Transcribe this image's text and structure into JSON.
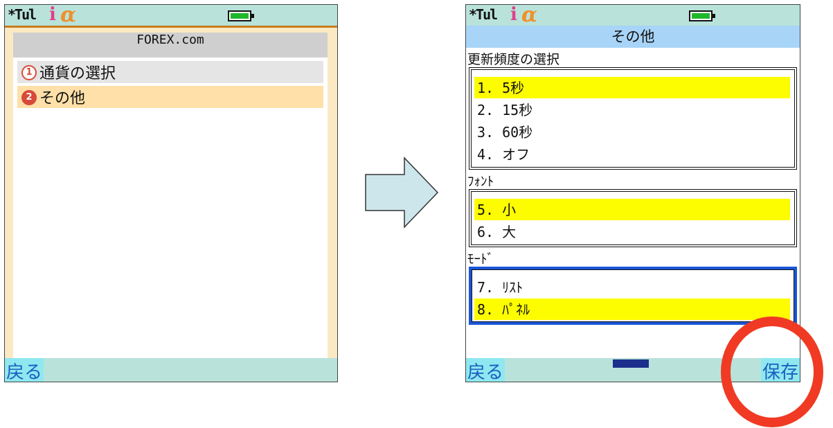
{
  "left_screen": {
    "status": {
      "signal": "*Tul",
      "imode": "i",
      "alpha": "α"
    },
    "title": "FOREX.com",
    "menu": [
      {
        "number": "1",
        "label": "通貨の選択"
      },
      {
        "number": "2",
        "label": "その他"
      }
    ],
    "softkey_left": "戻る"
  },
  "right_screen": {
    "status": {
      "signal": "*Tul",
      "imode": "i",
      "alpha": "α"
    },
    "title": "その他",
    "groups": [
      {
        "label": "更新頻度の選択",
        "options": [
          "1. 5秒",
          "2. 15秒",
          "3. 60秒",
          "4. オフ"
        ],
        "selected": 0
      },
      {
        "label": "ﾌｫﾝﾄ",
        "options": [
          "5. 小",
          "6. 大"
        ],
        "selected": 0
      },
      {
        "label": "ﾓｰﾄﾞ",
        "options": [
          "7. ﾘｽﾄ",
          "8. ﾊﾟﾈﾙ"
        ],
        "selected": 1
      }
    ],
    "softkey_left": "戻る",
    "softkey_right": "保存"
  },
  "colors": {
    "selected_option": "#fdfd00",
    "softkey_bar": "#b9e3da",
    "highlight_ring": "#f03a24",
    "arrow_fill": "#cce6ec"
  },
  "icons": [
    "signal-icon",
    "imode-icon",
    "alpha-icon",
    "battery-icon",
    "right-arrow-icon"
  ]
}
